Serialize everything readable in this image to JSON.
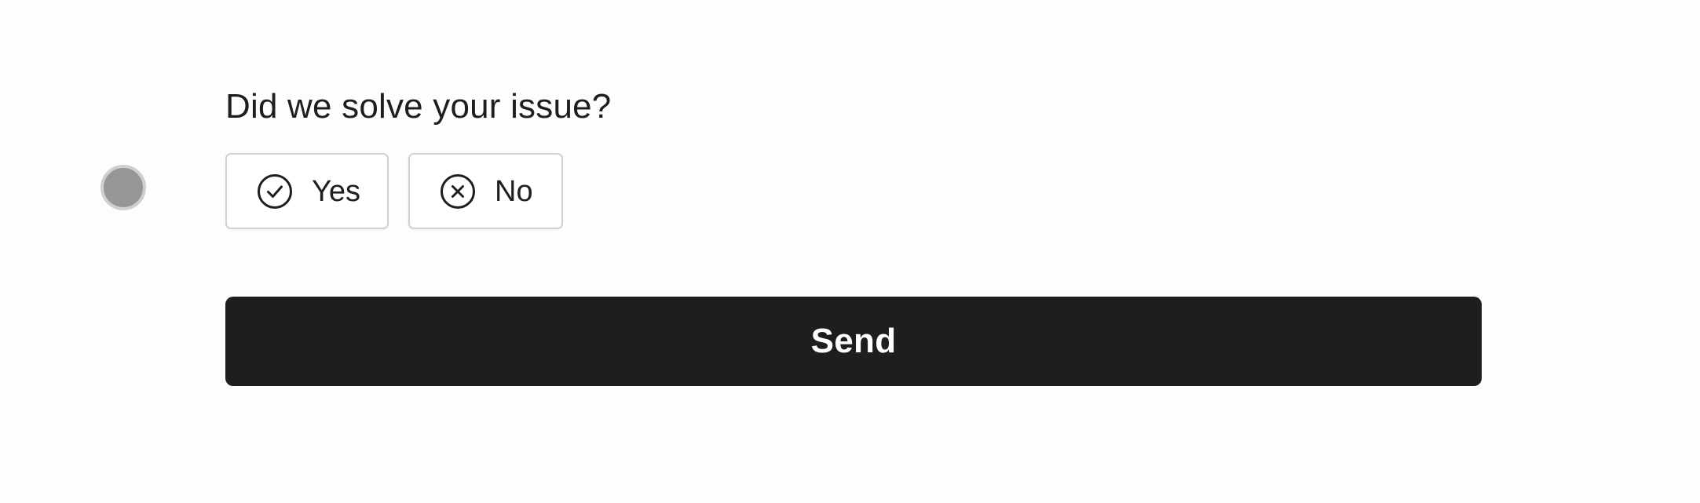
{
  "feedback": {
    "question": "Did we solve your issue?",
    "options": [
      {
        "label": "Yes",
        "icon": "check-circle-icon"
      },
      {
        "label": "No",
        "icon": "x-circle-icon"
      }
    ],
    "submit_label": "Send"
  },
  "colors": {
    "background": "#fdfdfd",
    "text": "#1e1e1e",
    "button_bg": "#1e1e1e",
    "button_text": "#ffffff",
    "choice_border": "#d2d2d6",
    "indicator": "#969696"
  }
}
